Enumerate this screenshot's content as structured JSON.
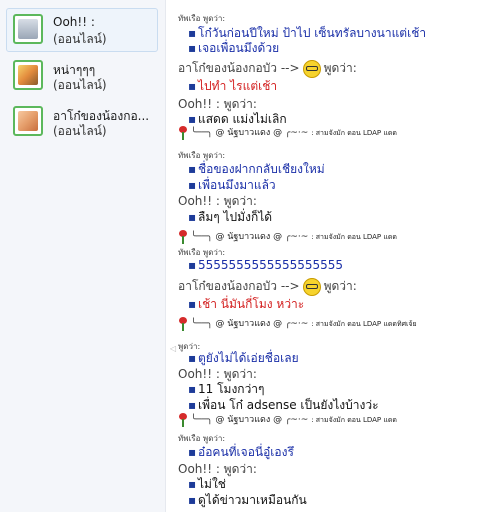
{
  "contacts": [
    {
      "name": "Ooh!! :",
      "status": "(ออนไลน์)",
      "selected": true,
      "avatar": "msn-default-avatar"
    },
    {
      "name": "หน่าๆๆๆ",
      "status": "(ออนไลน์)",
      "selected": false,
      "avatar": "cartoon-avatar"
    },
    {
      "name": "อาโก๋ของน้องกอ...",
      "status": "(ออนไลน์)",
      "selected": false,
      "avatar": "baby-photo-avatar"
    }
  ],
  "chat": {
    "h1": "ทัพเรือ พูดว่า:",
    "m1": "โก๋วันก่อนปีใหม่ ป้าไป เซ็นทรัลบางนาแต่เช้า",
    "m2": "เจอเพื่อนมึงด้วย",
    "h2_name": "อาโก๋ของน้องกอบัว -->",
    "h2_says": "พูดว่า:",
    "m3": "ไปทำ ไรแต่เช้า",
    "h3": "Ooh!! : พูดว่า:",
    "m4": "แสดด แม่งไม่เลิก",
    "sig1": "@ นัฐบาวแดง @",
    "sig1_tail": ": สามจังมัก ดอน LDAP แดด",
    "h4": "ทัพเรือ พูดว่า:",
    "m5": "ชื่อของฝากกลับเชียงใหม่",
    "m6": "เพื่อนมึงมาแล้ว",
    "h5": "Ooh!! : พูดว่า:",
    "m7": "ลืมๆ ไปมั่งก็ได้",
    "sig2": "@ นัฐบาวแดง @",
    "sig2_tail": ": สามจังมัก ดอน LDAP แดด",
    "h6": "ทัพเรือ พูดว่า:",
    "m8": "5555555555555555555",
    "h7_name": "อาโก๋ของน้องกอบัว -->",
    "h7_says": "พูดว่า:",
    "m9": "เช้า นี่มันกี่โมง หว่าะ",
    "sig3": "@ นัฐบาวแดง @",
    "sig3_tail": ": สามจังมัก ดอน LDAP แดดทิศเจ้ย",
    "h8": "พูดว่า:",
    "m10": "ตูยังไม่ได้เอ่ยชื่อเลย",
    "h9": "Ooh!! : พูดว่า:",
    "m11": "11 โมงกว่าๆ",
    "m12": "เพื่อน โก๋ adsense เป็นยังไงบ้างว่ะ",
    "sig4": "@ นัฐบาวแดง @",
    "sig4_tail": ": สามจังมัก ดอน LDAP แดด",
    "h10": "ทัพเรือ พูดว่า:",
    "m13": "อ๋อคนที่เจอนี่อู๋เองรึ",
    "h11": "Ooh!! : พูดว่า:",
    "m14": "ไม่ใช่",
    "m15": "ดูได้ข่าวมาเหมือนกัน"
  },
  "colors": {
    "link_blue": "#1a2fa8",
    "red_text": "#d31f1f",
    "online_green": "#5cb85c"
  }
}
